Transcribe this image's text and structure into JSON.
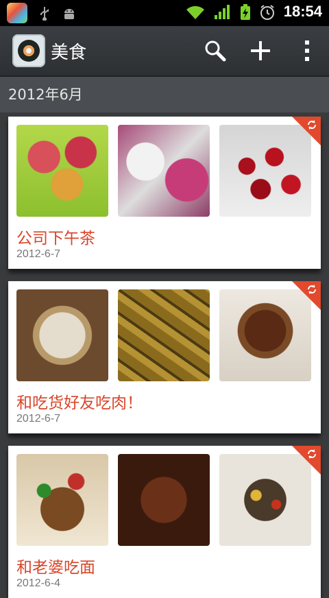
{
  "status": {
    "time": "18:54"
  },
  "app": {
    "title": "美食"
  },
  "section": {
    "label": "2012年6月"
  },
  "albums": [
    {
      "title": "公司下午茶",
      "date": "2012-6-7"
    },
    {
      "title": "和吃货好友吃肉！",
      "date": "2012-6-7"
    },
    {
      "title": "和老婆吃面",
      "date": "2012-6-4"
    }
  ],
  "colors": {
    "accent": "#d8452a",
    "corner": "#e2492d",
    "actionbar": "#2d3033"
  }
}
